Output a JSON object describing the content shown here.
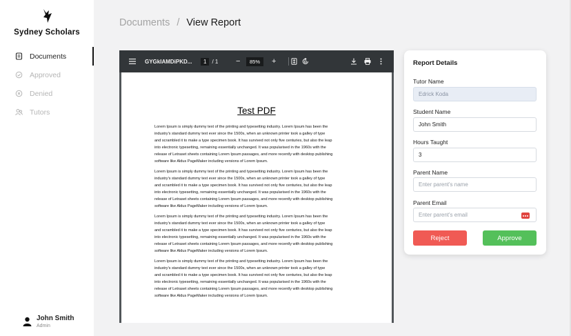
{
  "sidebar": {
    "brand": "Sydney Scholars",
    "logo_icon": "flame-logo-icon",
    "items": [
      {
        "label": "Documents",
        "icon": "document-icon",
        "active": true
      },
      {
        "label": "Approved",
        "icon": "check-circle-icon",
        "active": false
      },
      {
        "label": "Denied",
        "icon": "x-circle-icon",
        "active": false
      },
      {
        "label": "Tutors",
        "icon": "users-icon",
        "active": false
      }
    ],
    "user": {
      "name": "John Smith",
      "role": "Admin"
    }
  },
  "breadcrumb": {
    "parent": "Documents",
    "separator": "/",
    "current": "View Report"
  },
  "viewer": {
    "file_name": "GYGkIAMDiPKD...",
    "page_current": "1",
    "page_total": "/ 1",
    "zoom_out": "−",
    "zoom": "85%",
    "zoom_in": "+",
    "pdf_title": "Test PDF",
    "paragraph_lines": [
      "Lorem Ipsum is simply dummy text of the printing and typesetting industry. Lorem Ipsum has been the",
      "industry's standard dummy text ever since the 1500s, when an unknown printer took a galley of type",
      "and scrambled it to make a type specimen book. It has survived not only five centuries, but also the leap",
      "into electronic typesetting, remaining essentially unchanged. It was popularised in the 1960s with the",
      "release of Letraset sheets containing Lorem Ipsum passages, and more recently with desktop publishing",
      "software like Aldus PageMaker including versions of Lorem Ipsum."
    ]
  },
  "report": {
    "title": "Report Details",
    "tutor_label": "Tutor Name",
    "tutor_value": "Edrick Koda",
    "student_label": "Student Name",
    "student_value": "John Smith",
    "hours_label": "Hours Taught",
    "hours_value": "3",
    "parent_name_label": "Parent Name",
    "parent_name_placeholder": "Enter parent's name",
    "parent_email_label": "Parent Email",
    "parent_email_placeholder": "Enter parent's email",
    "reject_label": "Reject",
    "approve_label": "Approve"
  },
  "colors": {
    "reject": "#f05a54",
    "approve": "#54c05a",
    "toolbar": "#323639",
    "viewer_bg": "#525659"
  }
}
